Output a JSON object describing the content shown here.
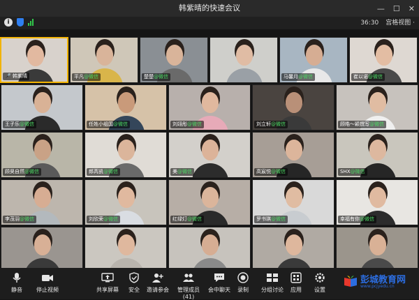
{
  "window": {
    "title": "韩紫晴的快速会议"
  },
  "infobar": {
    "time": "36:30",
    "view_label": "宫格视图 ·"
  },
  "participants": [
    {
      "name": "韩紫晴",
      "active": true,
      "icon": "mic-icon",
      "bg": "#d8d2cc",
      "skin": "#e2b9a0",
      "shirt": "#3a3a3a"
    },
    {
      "name": "平凡",
      "tag": "@微信",
      "bg": "#cfc7b8",
      "skin": "#d9b49a",
      "shirt": "#d9b54a"
    },
    {
      "name": "楚楚",
      "tag": "@微信",
      "bg": "#8a8f94",
      "skin": "#d9b49a",
      "shirt": "#6a6a6a"
    },
    {
      "name": "",
      "bg": "#cfcfcb",
      "skin": "#e0bca4",
      "shirt": "#9aa0a6"
    },
    {
      "name": "马馨月",
      "tag": "@微信",
      "bg": "#a8b6c2",
      "skin": "#d6ad93",
      "shirt": "#e8e8e8"
    },
    {
      "name": "崔以诺",
      "tag": "@微信",
      "bg": "#ded8d2",
      "skin": "#e3bda3",
      "shirt": "#4a4a4a"
    },
    {
      "name": "王子乐",
      "tag": "@微信",
      "bg": "#c4c8cc",
      "skin": "#d9b296",
      "shirt": "#2a2a2a"
    },
    {
      "name": "任姓小组国",
      "tag": "@微信",
      "bg": "#d6c2a8",
      "skin": "#c99a7a",
      "shirt": "#34465a"
    },
    {
      "name": "刘翊彤",
      "tag": "@微信",
      "bg": "#b8b0ac",
      "skin": "#e0b89e",
      "shirt": "#e7aab8"
    },
    {
      "name": "刘立轩",
      "tag": "@微信",
      "bg": "#4a4440",
      "skin": "#b99078",
      "shirt": "#3a3a3a"
    },
    {
      "name": "顾皓～颖撰写",
      "tag": "@微信",
      "bg": "#c7c2bd",
      "skin": "#e0bca2",
      "shirt": "#efefef"
    },
    {
      "name": "顾昊自然",
      "tag": "@微信",
      "bg": "#b9b6a8",
      "skin": "#c9a286",
      "shirt": "#5a5a5a"
    },
    {
      "name": "郎芮凯",
      "tag": "@微信",
      "bg": "#e0dcd6",
      "skin": "#dbb59b",
      "shirt": "#6a6a6a"
    },
    {
      "name": "美",
      "tag": "@微信",
      "bg": "#d3d0cb",
      "skin": "#dcb399",
      "shirt": "#2c2c2c"
    },
    {
      "name": "高宸悦",
      "tag": "@微信",
      "bg": "#a79e96",
      "skin": "#dcb59b",
      "shirt": "#262626"
    },
    {
      "name": "SHX",
      "tag": "@微信",
      "bg": "#c9c6bd",
      "skin": "#ddb89f",
      "shirt": "#262626"
    },
    {
      "name": "李茂羽",
      "tag": "@微信",
      "bg": "#bdb6ad",
      "skin": "#d7ad93",
      "shirt": "#b3b9bd"
    },
    {
      "name": "刘欣荣",
      "tag": "@微信",
      "bg": "#c8c4bc",
      "skin": "#e0b99f",
      "shirt": "#d9dde2"
    },
    {
      "name": "红绿灯",
      "tag": "@微信",
      "bg": "#b7aea6",
      "skin": "#dbb59b",
      "shirt": "#2a2a2a"
    },
    {
      "name": "罗书琪",
      "tag": "@微信",
      "bg": "#d9d9d9",
      "skin": "#e0bca2",
      "shirt": "#c8ccd0"
    },
    {
      "name": "幸福有你",
      "tag": "@微信",
      "bg": "#e8e6e2",
      "skin": "#e0baa0",
      "shirt": "#2c2c2c"
    },
    {
      "name": "",
      "bg": "#9a9590",
      "skin": "#d8b096",
      "shirt": "#3a3a3a"
    },
    {
      "name": "",
      "bg": "#cbc7c0",
      "skin": "#dfb89e",
      "shirt": "#b9b4ad"
    },
    {
      "name": "",
      "bg": "#c7c3bd",
      "skin": "#d6ad93",
      "shirt": "#8a8a8a"
    },
    {
      "name": "",
      "bg": "#b0aaa3",
      "skin": "#deb79d",
      "shirt": "#3a3a3a"
    },
    {
      "name": "",
      "bg": "#9b958c",
      "skin": "#d9b196",
      "shirt": "#4a4a4a"
    }
  ],
  "toolbar": {
    "mute": "静音",
    "stop_video": "停止视频",
    "share_screen": "共享屏幕",
    "security": "安全",
    "invite": "邀请参会",
    "manage": "管理成员(41)",
    "chat": "会中聊天",
    "record": "录制",
    "breakout": "分组讨论",
    "apps": "应用",
    "settings": "设置"
  },
  "watermark": {
    "title": "彭城教育网",
    "url": "www.pcjyedu.cn"
  }
}
